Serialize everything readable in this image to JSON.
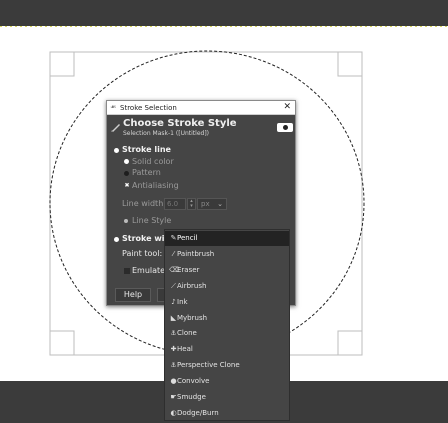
{
  "dialog": {
    "window_title": "Stroke Selection",
    "close_glyph": "✕",
    "heading": "Choose Stroke Style",
    "subheading": "Selection Mask-1 ([Untitled])",
    "stroke_line": {
      "label": "Stroke line",
      "solid_color": "Solid color",
      "pattern": "Pattern",
      "antialiasing": "Antialiasing",
      "line_width_label": "Line width:",
      "line_width_value": "6.0",
      "unit": "px",
      "line_style": "Line Style"
    },
    "stroke_paint": {
      "label": "Stroke wi",
      "paint_tool_label": "Paint tool:",
      "emulate_label": "Emulate"
    },
    "buttons": {
      "help": "Help"
    }
  },
  "menu": {
    "selected": "Pencil",
    "items": [
      {
        "label": "Pencil",
        "icon": "pencil-icon",
        "glyph": "✎"
      },
      {
        "label": "Paintbrush",
        "icon": "paintbrush-icon",
        "glyph": "⁄"
      },
      {
        "label": "Eraser",
        "icon": "eraser-icon",
        "glyph": "⌫"
      },
      {
        "label": "Airbrush",
        "icon": "airbrush-icon",
        "glyph": "⟋"
      },
      {
        "label": "Ink",
        "icon": "ink-icon",
        "glyph": "♪"
      },
      {
        "label": "Mybrush",
        "icon": "mybrush-icon",
        "glyph": "◣"
      },
      {
        "label": "Clone",
        "icon": "clone-icon",
        "glyph": "⚓"
      },
      {
        "label": "Heal",
        "icon": "heal-icon",
        "glyph": "✚"
      },
      {
        "label": "Perspective Clone",
        "icon": "perspective-clone-icon",
        "glyph": "⚓"
      },
      {
        "label": "Convolve",
        "icon": "convolve-icon",
        "glyph": "●"
      },
      {
        "label": "Smudge",
        "icon": "smudge-icon",
        "glyph": "☛"
      },
      {
        "label": "Dodge/Burn",
        "icon": "dodge-burn-icon",
        "glyph": "◐"
      }
    ]
  }
}
